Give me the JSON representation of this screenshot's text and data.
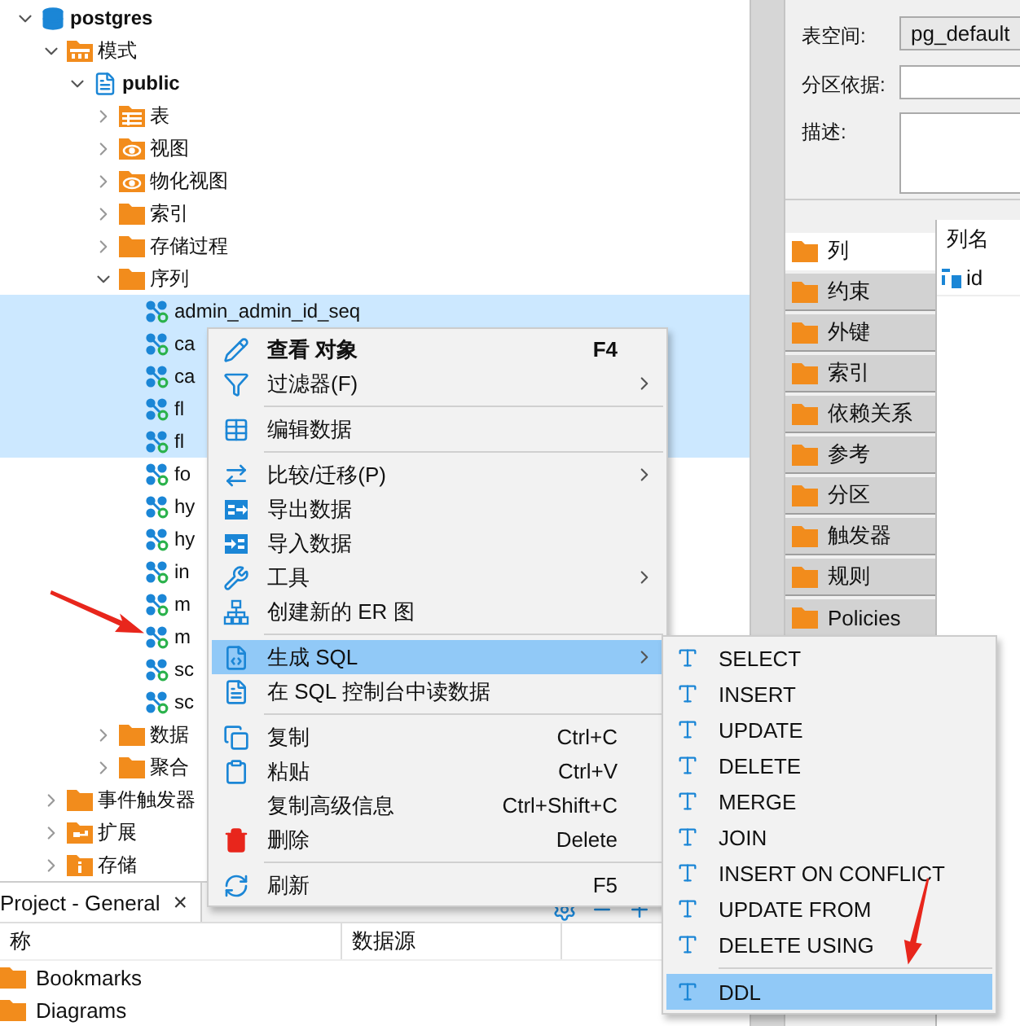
{
  "tree": [
    {
      "label": "postgres",
      "kind": "database",
      "bold": true,
      "expanded": true,
      "selected": false,
      "children": [
        {
          "label": "模式",
          "kind": "schemas",
          "bold": false,
          "expanded": true,
          "selected": false,
          "children": [
            {
              "label": "public",
              "kind": "schema",
              "bold": true,
              "expanded": true,
              "selected": false,
              "children": [
                {
                  "label": "表",
                  "kind": "table-folder",
                  "bold": false,
                  "expanded": false,
                  "selected": false
                },
                {
                  "label": "视图",
                  "kind": "view-folder",
                  "bold": false,
                  "expanded": false,
                  "selected": false
                },
                {
                  "label": "物化视图",
                  "kind": "view-folder",
                  "bold": false,
                  "expanded": false,
                  "selected": false
                },
                {
                  "label": "索引",
                  "kind": "folder",
                  "bold": false,
                  "expanded": false,
                  "selected": false
                },
                {
                  "label": "存储过程",
                  "kind": "folder",
                  "bold": false,
                  "expanded": false,
                  "selected": false
                },
                {
                  "label": "序列",
                  "kind": "folder",
                  "bold": false,
                  "expanded": true,
                  "selected": false,
                  "children": [
                    {
                      "label": "admin_admin_id_seq",
                      "kind": "sequence",
                      "bold": false,
                      "selected": true
                    },
                    {
                      "label": "ca",
                      "kind": "sequence",
                      "bold": false,
                      "selected": true
                    },
                    {
                      "label": "ca",
                      "kind": "sequence",
                      "bold": false,
                      "selected": true
                    },
                    {
                      "label": "fl",
                      "kind": "sequence",
                      "bold": false,
                      "selected": true
                    },
                    {
                      "label": "fl",
                      "kind": "sequence",
                      "bold": false,
                      "selected": true
                    },
                    {
                      "label": "fo",
                      "kind": "sequence",
                      "bold": false,
                      "selected": false
                    },
                    {
                      "label": "hy",
                      "kind": "sequence",
                      "bold": false,
                      "selected": false
                    },
                    {
                      "label": "hy",
                      "kind": "sequence",
                      "bold": false,
                      "selected": false
                    },
                    {
                      "label": "in",
                      "kind": "sequence",
                      "bold": false,
                      "selected": false
                    },
                    {
                      "label": "m",
                      "kind": "sequence",
                      "bold": false,
                      "selected": false
                    },
                    {
                      "label": "m",
                      "kind": "sequence",
                      "bold": false,
                      "selected": false
                    },
                    {
                      "label": "sc",
                      "kind": "sequence",
                      "bold": false,
                      "selected": false
                    },
                    {
                      "label": "sc",
                      "kind": "sequence",
                      "bold": false,
                      "selected": false
                    }
                  ]
                },
                {
                  "label": "数据",
                  "kind": "folder",
                  "bold": false,
                  "expanded": false,
                  "selected": false
                },
                {
                  "label": "聚合",
                  "kind": "folder",
                  "bold": false,
                  "expanded": false,
                  "selected": false
                }
              ]
            }
          ]
        },
        {
          "label": "事件触发器",
          "kind": "folder",
          "bold": false,
          "expanded": false,
          "selected": false
        },
        {
          "label": "扩展",
          "kind": "extension-folder",
          "bold": false,
          "expanded": false,
          "selected": false
        },
        {
          "label": "存储",
          "kind": "storage-folder",
          "bold": false,
          "expanded": false,
          "selected": false
        }
      ]
    }
  ],
  "project_panel": {
    "tab": "Project - General",
    "close": "×",
    "columns": [
      "称",
      "数据源"
    ],
    "rows": [
      {
        "label": "Bookmarks"
      },
      {
        "label": "Diagrams"
      }
    ]
  },
  "properties": {
    "fields": [
      {
        "label": "表空间:",
        "kind": "readonly",
        "value": "pg_default"
      },
      {
        "label": "分区依据:",
        "kind": "text"
      },
      {
        "label": "描述:",
        "kind": "textarea"
      }
    ],
    "tabs": [
      {
        "label": "列",
        "selected": true
      },
      {
        "label": "约束",
        "selected": false
      },
      {
        "label": "外键",
        "selected": false
      },
      {
        "label": "索引",
        "selected": false
      },
      {
        "label": "依赖关系",
        "selected": false
      },
      {
        "label": "参考",
        "selected": false
      },
      {
        "label": "分区",
        "selected": false
      },
      {
        "label": "触发器",
        "selected": false
      },
      {
        "label": "规则",
        "selected": false
      },
      {
        "label": "Policies",
        "selected": false
      }
    ],
    "columns_table": {
      "header": "列名",
      "rows": [
        "id"
      ]
    }
  },
  "context_menu": {
    "items": [
      {
        "kind": "item",
        "label": "查看 对象",
        "shortcut": "F4",
        "bold": true,
        "submenu": false,
        "selected": false
      },
      {
        "kind": "item",
        "label": "过滤器(F)",
        "bold": false,
        "submenu": true,
        "selected": false
      },
      {
        "kind": "separator"
      },
      {
        "kind": "item",
        "label": "编辑数据",
        "bold": false,
        "submenu": false,
        "selected": false
      },
      {
        "kind": "separator"
      },
      {
        "kind": "item",
        "label": "比较/迁移(P)",
        "bold": false,
        "submenu": true,
        "selected": false
      },
      {
        "kind": "item",
        "label": "导出数据",
        "bold": false,
        "submenu": false,
        "selected": false
      },
      {
        "kind": "item",
        "label": "导入数据",
        "bold": false,
        "submenu": false,
        "selected": false
      },
      {
        "kind": "item",
        "label": "工具",
        "bold": false,
        "submenu": true,
        "selected": false
      },
      {
        "kind": "item",
        "label": "创建新的 ER 图",
        "bold": false,
        "submenu": false,
        "selected": false
      },
      {
        "kind": "separator"
      },
      {
        "kind": "item",
        "label": "生成 SQL",
        "bold": false,
        "submenu": true,
        "selected": true
      },
      {
        "kind": "item",
        "label": "在 SQL 控制台中读数据",
        "bold": false,
        "submenu": false,
        "selected": false
      },
      {
        "kind": "separator"
      },
      {
        "kind": "item",
        "label": "复制",
        "shortcut": "Ctrl+C",
        "bold": false,
        "submenu": false,
        "selected": false
      },
      {
        "kind": "item",
        "label": "粘贴",
        "shortcut": "Ctrl+V",
        "bold": false,
        "submenu": false,
        "selected": false
      },
      {
        "kind": "item",
        "label": "复制高级信息",
        "shortcut": "Ctrl+Shift+C",
        "bold": false,
        "submenu": false,
        "selected": false
      },
      {
        "kind": "item",
        "label": "删除",
        "shortcut": "Delete",
        "bold": false,
        "submenu": false,
        "selected": false
      },
      {
        "kind": "separator"
      },
      {
        "kind": "item",
        "label": "刷新",
        "shortcut": "F5",
        "bold": false,
        "submenu": false,
        "selected": false
      }
    ]
  },
  "sql_submenu": {
    "items": [
      {
        "kind": "item",
        "label": "SELECT",
        "selected": false
      },
      {
        "kind": "item",
        "label": "INSERT",
        "selected": false
      },
      {
        "kind": "item",
        "label": "UPDATE",
        "selected": false
      },
      {
        "kind": "item",
        "label": "DELETE",
        "selected": false
      },
      {
        "kind": "item",
        "label": "MERGE",
        "selected": false
      },
      {
        "kind": "item",
        "label": "JOIN",
        "selected": false
      },
      {
        "kind": "item",
        "label": "INSERT ON CONFLICT",
        "selected": false
      },
      {
        "kind": "item",
        "label": "UPDATE FROM",
        "selected": false
      },
      {
        "kind": "item",
        "label": "DELETE USING",
        "selected": false
      },
      {
        "kind": "separator"
      },
      {
        "kind": "item",
        "label": "DDL",
        "selected": true
      }
    ]
  }
}
